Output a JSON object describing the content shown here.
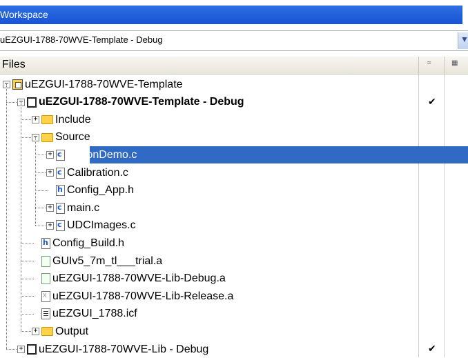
{
  "panel": {
    "title": "Workspace"
  },
  "config_dropdown": {
    "value": "uEZGUI-1788-70WVE-Template - Debug"
  },
  "tree_header": {
    "files": "Files"
  },
  "tree": [
    {
      "label": "uEZGUI-1788-70WVE-Template",
      "icon": "workspace-icon",
      "expander": "-",
      "depth": 0,
      "bold": false,
      "checked": false,
      "selected": false
    },
    {
      "label": "uEZGUI-1788-70WVE-Template - Debug",
      "icon": "project-icon",
      "expander": "-",
      "depth": 1,
      "bold": true,
      "checked": true,
      "selected": false
    },
    {
      "label": "Include",
      "icon": "folder-icon",
      "expander": "+",
      "depth": 2,
      "bold": false,
      "checked": false,
      "selected": false
    },
    {
      "label": "Source",
      "icon": "folder-icon",
      "expander": "-",
      "depth": 2,
      "bold": false,
      "checked": false,
      "selected": false
    },
    {
      "label": "ButtonDemo.c",
      "icon": "c-file-icon",
      "expander": "+",
      "depth": 3,
      "bold": false,
      "checked": false,
      "selected": true
    },
    {
      "label": "Calibration.c",
      "icon": "c-file-icon",
      "expander": "+",
      "depth": 3,
      "bold": false,
      "checked": false,
      "selected": false
    },
    {
      "label": "Config_App.h",
      "icon": "h-file-icon",
      "expander": "",
      "depth": 3,
      "bold": false,
      "checked": false,
      "selected": false
    },
    {
      "label": "main.c",
      "icon": "c-file-icon",
      "expander": "+",
      "depth": 3,
      "bold": false,
      "checked": false,
      "selected": false
    },
    {
      "label": "UDCImages.c",
      "icon": "c-file-icon",
      "expander": "+",
      "depth": 3,
      "bold": false,
      "checked": false,
      "selected": false
    },
    {
      "label": "Config_Build.h",
      "icon": "h-file-icon",
      "expander": "",
      "depth": 2,
      "bold": false,
      "checked": false,
      "selected": false
    },
    {
      "label": "GUIv5_7m_tl___trial.a",
      "icon": "library-file-icon",
      "expander": "",
      "depth": 2,
      "bold": false,
      "checked": false,
      "selected": false
    },
    {
      "label": "uEZGUI-1788-70WVE-Lib-Debug.a",
      "icon": "library-file-icon",
      "expander": "",
      "depth": 2,
      "bold": false,
      "checked": false,
      "selected": false
    },
    {
      "label": "uEZGUI-1788-70WVE-Lib-Release.a",
      "icon": "excluded-file-icon",
      "expander": "",
      "depth": 2,
      "bold": false,
      "checked": false,
      "selected": false
    },
    {
      "label": "uEZGUI_1788.icf",
      "icon": "icf-file-icon",
      "expander": "",
      "depth": 2,
      "bold": false,
      "checked": false,
      "selected": false
    },
    {
      "label": "Output",
      "icon": "folder-icon",
      "expander": "+",
      "depth": 2,
      "bold": false,
      "checked": false,
      "selected": false
    },
    {
      "label": "uEZGUI-1788-70WVE-Lib - Debug",
      "icon": "project-icon",
      "expander": "+",
      "depth": 1,
      "bold": false,
      "checked": true,
      "selected": false
    }
  ],
  "checkmark": "✔",
  "colors": {
    "title_bar": "#1653d6",
    "selection": "#316ac5",
    "folder": "#ffd24a"
  }
}
